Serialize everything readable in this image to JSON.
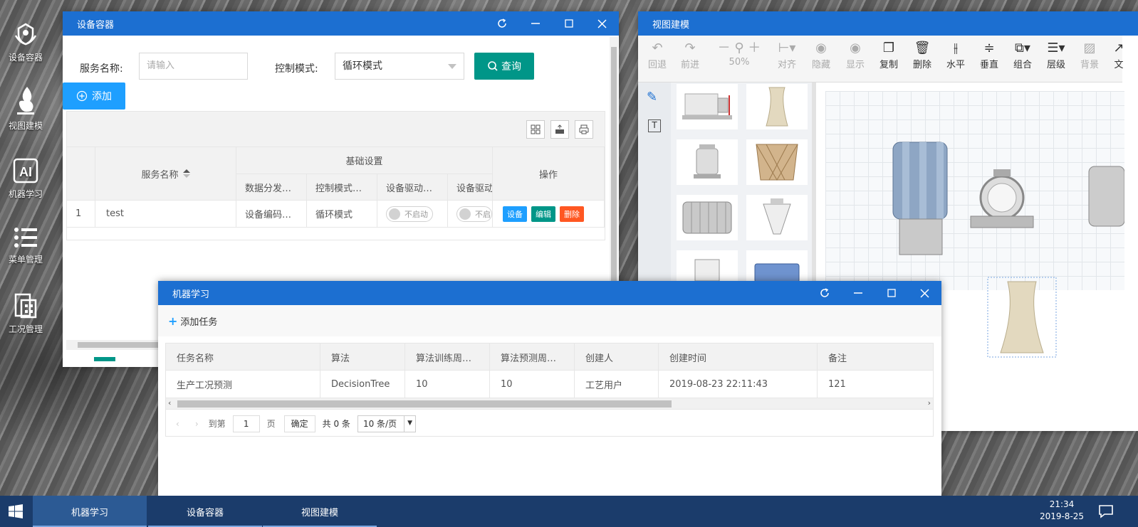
{
  "desktop": {
    "icons": [
      {
        "label": "设备容器",
        "icon": "device-container-icon"
      },
      {
        "label": "视图建模",
        "icon": "view-model-icon"
      },
      {
        "label": "机器学习",
        "icon": "machine-learning-icon"
      },
      {
        "label": "菜单管理",
        "icon": "menu-management-icon"
      },
      {
        "label": "工况管理",
        "icon": "condition-management-icon"
      }
    ]
  },
  "device_window": {
    "title": "设备容器",
    "service_label": "服务名称:",
    "service_placeholder": "请输入",
    "mode_label": "控制模式:",
    "mode_value": "循环模式",
    "query_label": "查询",
    "add_label": "添加",
    "group_header": "基础设置",
    "ops_header": "操作",
    "columns": [
      "服务名称",
      "数据分发…",
      "控制模式…",
      "设备驱动…",
      "设备驱动"
    ],
    "rows": [
      {
        "index": "1",
        "name": "test",
        "data": "设备编码…",
        "mode": "循环模式",
        "drive1": "不启动",
        "drive2": "不启"
      }
    ],
    "actions": [
      "设备",
      "编辑",
      "删除"
    ]
  },
  "model_window": {
    "title": "视图建模",
    "tools": [
      {
        "label": "回退",
        "icon": "undo-icon"
      },
      {
        "label": "前进",
        "icon": "redo-icon"
      },
      {
        "label": "50%",
        "icon": "zoom-icon"
      },
      {
        "label": "对齐",
        "icon": "align-icon"
      },
      {
        "label": "隐藏",
        "icon": "hide-icon"
      },
      {
        "label": "显示",
        "icon": "show-icon"
      },
      {
        "label": "复制",
        "icon": "copy-icon"
      },
      {
        "label": "删除",
        "icon": "delete-icon"
      },
      {
        "label": "水平",
        "icon": "horizontal-icon"
      },
      {
        "label": "垂直",
        "icon": "vertical-icon"
      },
      {
        "label": "组合",
        "icon": "group-icon"
      },
      {
        "label": "层级",
        "icon": "layer-icon"
      },
      {
        "label": "背景",
        "icon": "background-icon"
      },
      {
        "label": "文",
        "icon": "text-icon"
      }
    ]
  },
  "ml_window": {
    "title": "机器学习",
    "add_task": "添加任务",
    "columns": [
      "任务名称",
      "算法",
      "算法训练周…",
      "算法预测周…",
      "创建人",
      "创建时间",
      "备注"
    ],
    "rows": [
      [
        "生产工况预测",
        "DecisionTree",
        "10",
        "10",
        "工艺用户",
        "2019-08-23 22:11:43",
        "121"
      ]
    ],
    "pager": {
      "goto": "到第",
      "page": "1",
      "page_unit": "页",
      "confirm": "确定",
      "total": "共 0 条",
      "per_page": "10 条/页"
    }
  },
  "taskbar": {
    "items": [
      "机器学习",
      "设备容器",
      "视图建模"
    ],
    "time": "21:34",
    "date": "2019-8-25"
  },
  "colors": {
    "titlebar": "#1c6fd1",
    "teal": "#009688",
    "blue": "#1e9fff",
    "red": "#ff5722",
    "taskbar": "#1b3c6b"
  }
}
